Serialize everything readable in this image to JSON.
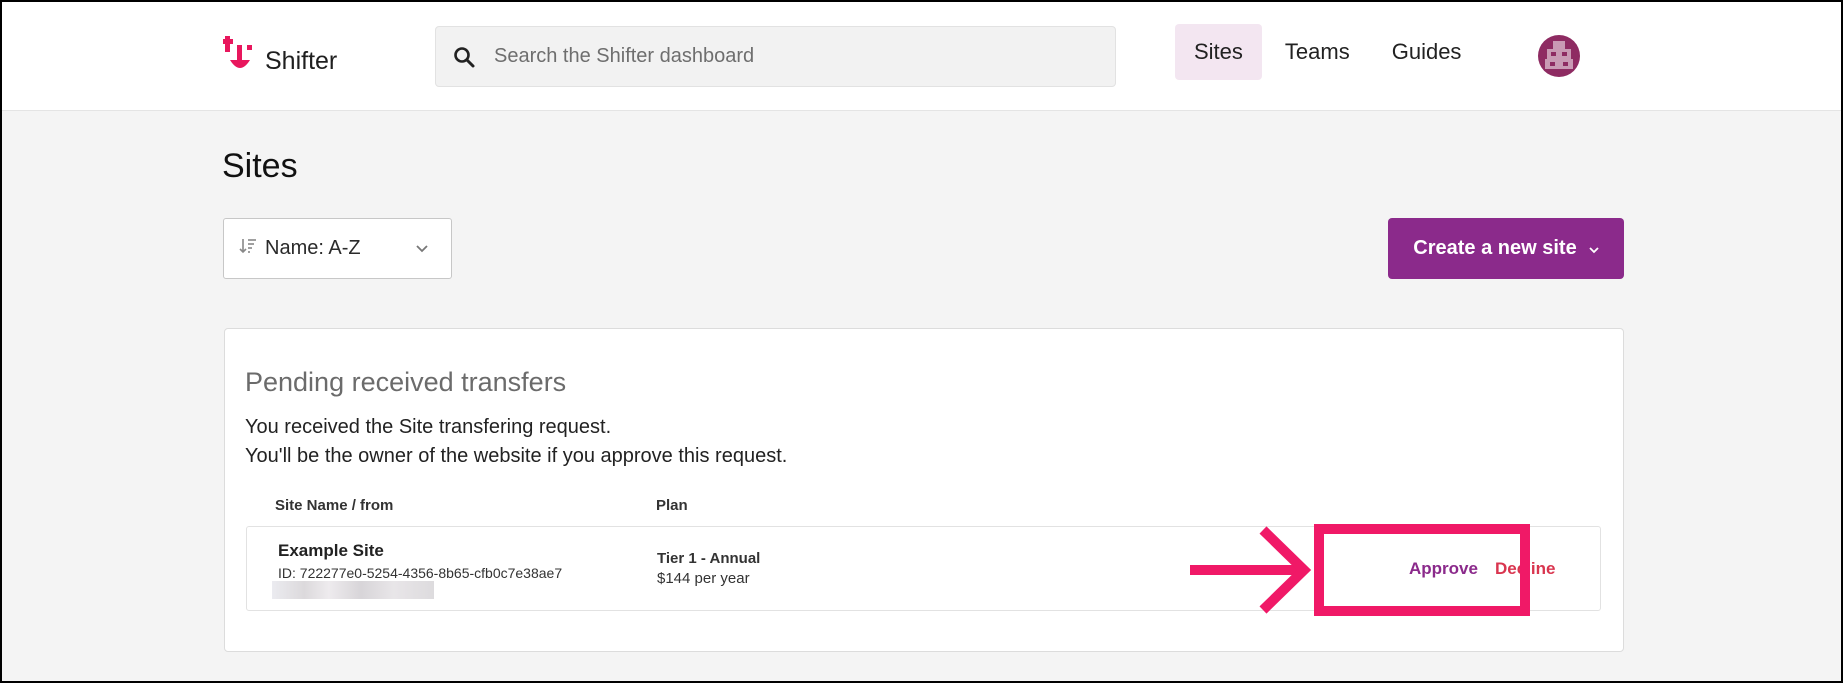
{
  "app": {
    "name": "Shifter",
    "brand_color": "#e8175d",
    "accent_color": "#8b2a8b"
  },
  "search": {
    "placeholder": "Search the Shifter dashboard"
  },
  "nav": {
    "items": [
      {
        "label": "Sites",
        "active": true
      },
      {
        "label": "Teams",
        "active": false
      },
      {
        "label": "Guides",
        "active": false
      }
    ]
  },
  "page": {
    "title": "Sites"
  },
  "sort": {
    "value": "Name: A-Z"
  },
  "create_button": {
    "label": "Create a new site"
  },
  "transfers": {
    "title": "Pending received transfers",
    "description_line1": "You received the Site transfering request.",
    "description_line2": "You'll be the owner of the website if you approve this request.",
    "columns": {
      "site": "Site Name / from",
      "plan": "Plan"
    },
    "rows": [
      {
        "site_name": "Example Site",
        "site_id": "ID: 722277e0-5254-4356-8b65-cfb0c7e38ae7",
        "plan_name": "Tier 1 - Annual",
        "plan_price": "$144 per year",
        "approve_label": "Approve",
        "decline_label": "Decline"
      }
    ]
  },
  "annotation": {
    "color": "#f01967"
  }
}
